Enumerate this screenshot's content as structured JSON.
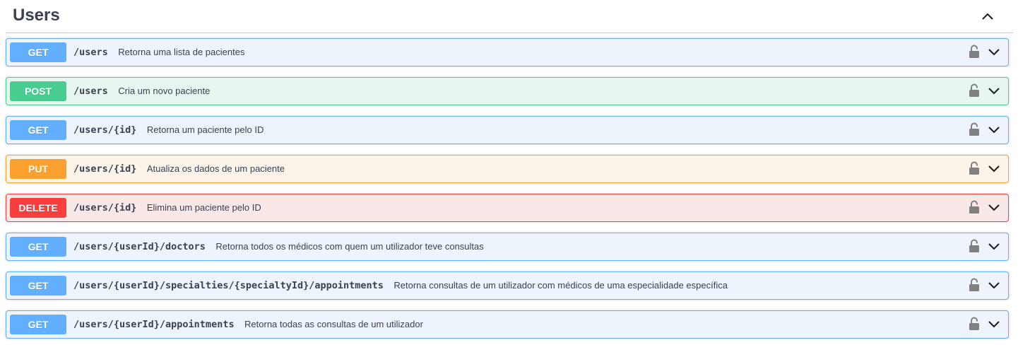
{
  "section": {
    "title": "Users",
    "toggle_icon": "chevron-up-icon"
  },
  "operations": [
    {
      "method": "GET",
      "path": "/users",
      "summary": "Retorna uma lista de pacientes"
    },
    {
      "method": "POST",
      "path": "/users",
      "summary": "Cria um novo paciente"
    },
    {
      "method": "GET",
      "path": "/users/{id}",
      "summary": "Retorna um paciente pelo ID"
    },
    {
      "method": "PUT",
      "path": "/users/{id}",
      "summary": "Atualiza os dados de um paciente"
    },
    {
      "method": "DELETE",
      "path": "/users/{id}",
      "summary": "Elimina um paciente pelo ID"
    },
    {
      "method": "GET",
      "path": "/users/{userId}/doctors",
      "summary": "Retorna todos os médicos com quem um utilizador teve consultas"
    },
    {
      "method": "GET",
      "path": "/users/{userId}/specialties/{specialtyId}/appointments",
      "summary": "Retorna consultas de um utilizador com médicos de uma especialidade específica"
    },
    {
      "method": "GET",
      "path": "/users/{userId}/appointments",
      "summary": "Retorna todas as consultas de um utilizador"
    }
  ],
  "colors": {
    "get": "#61affe",
    "post": "#49cc90",
    "put": "#fca130",
    "delete": "#f93e3e",
    "text": "#3b4151"
  },
  "icons": {
    "lock": "unlock-icon",
    "expand": "chevron-down-icon"
  }
}
